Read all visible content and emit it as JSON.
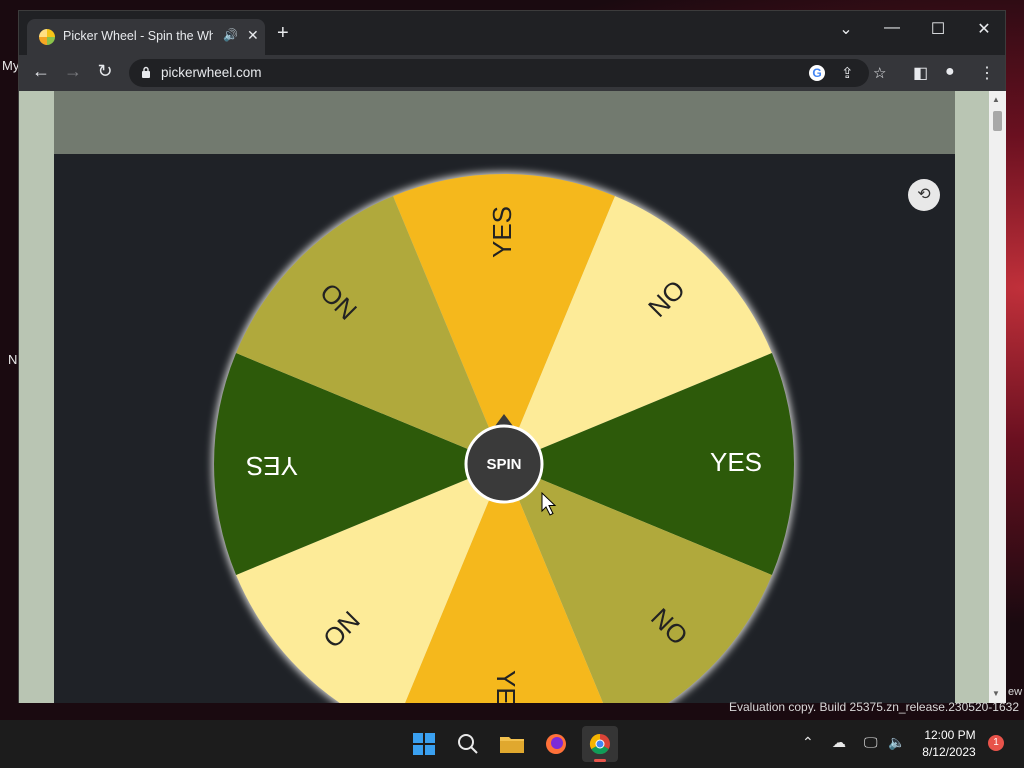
{
  "desktop": {
    "left_text_1": "My",
    "left_text_2": "N",
    "side_text": "ew",
    "evaluation": "Evaluation copy. Build 25375.zn_release.230520-1632"
  },
  "browser": {
    "tab_title": "Picker Wheel - Spin the Wheel",
    "url": "pickerwheel.com"
  },
  "wheel": {
    "spin_label": "SPIN",
    "slices": [
      {
        "label": "YES",
        "color": "#f5b81c"
      },
      {
        "label": "NO",
        "color": "#fdeb98"
      },
      {
        "label": "YES",
        "color": "#2d5a0a"
      },
      {
        "label": "NO",
        "color": "#b0a93c"
      },
      {
        "label": "YES",
        "color": "#f5b81c"
      },
      {
        "label": "NO",
        "color": "#fdeb98"
      },
      {
        "label": "YES",
        "color": "#2d5a0a"
      },
      {
        "label": "NO",
        "color": "#b0a93c"
      }
    ]
  },
  "taskbar": {
    "time": "12:00 PM",
    "date": "8/12/2023",
    "notification_count": "1"
  }
}
